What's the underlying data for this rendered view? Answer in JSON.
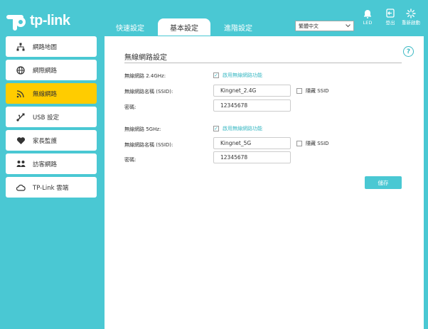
{
  "brand": {
    "name": "tp-link"
  },
  "tabs": [
    {
      "label": "快速設定"
    },
    {
      "label": "基本設定"
    },
    {
      "label": "進階設定"
    }
  ],
  "language": {
    "selected": "繁體中文"
  },
  "header_icons": {
    "led": "LED",
    "logout": "登出",
    "reboot": "重新啟動"
  },
  "sidebar": {
    "items": [
      {
        "label": "網路地圖",
        "icon": "network-map-icon"
      },
      {
        "label": "網際網路",
        "icon": "globe-icon"
      },
      {
        "label": "無線網路",
        "icon": "wifi-icon"
      },
      {
        "label": "USB 設定",
        "icon": "usb-icon"
      },
      {
        "label": "家長監護",
        "icon": "heart-icon"
      },
      {
        "label": "訪客網路",
        "icon": "guest-icon"
      },
      {
        "label": "TP-Link 雲端",
        "icon": "cloud-icon"
      }
    ]
  },
  "panel": {
    "title": "無線網路設定",
    "band24": {
      "label": "無線網路 2.4GHz:",
      "enable_label": "啟用無線網路功能",
      "ssid_label": "無線網路名稱 (SSID):",
      "ssid_value": "Kingnet_2.4G",
      "hide_label": "隱藏 SSID",
      "password_label": "密碼:",
      "password_value": "12345678"
    },
    "band5": {
      "label": "無線網路 5GHz:",
      "enable_label": "啟用無線網路功能",
      "ssid_label": "無線網路名稱 (SSID):",
      "ssid_value": "Kingnet_5G",
      "hide_label": "隱藏 SSID",
      "password_label": "密碼:",
      "password_value": "12345678"
    },
    "save_label": "儲存"
  },
  "colors": {
    "accent": "#4ac8d3",
    "active": "#ffcc00"
  }
}
